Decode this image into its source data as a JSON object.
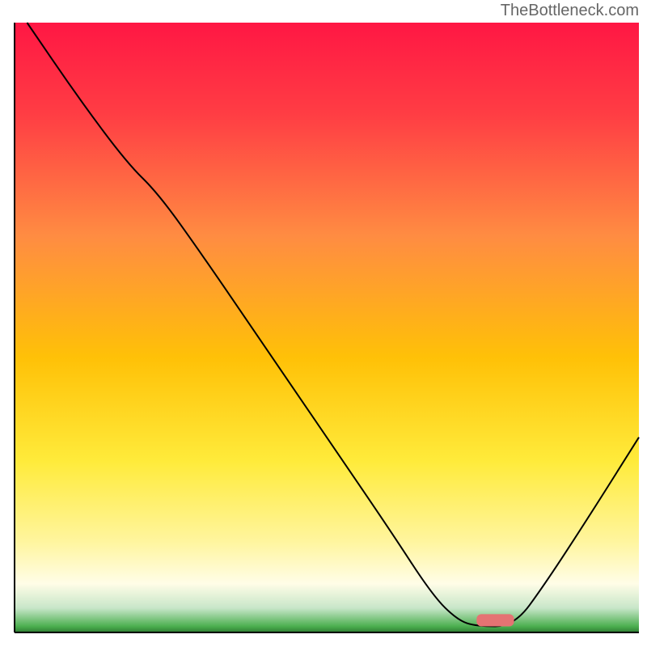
{
  "watermark": "TheBottleneck.com",
  "chart_data": {
    "type": "line",
    "title": "",
    "xlabel": "",
    "ylabel": "",
    "xlim": [
      0,
      100
    ],
    "ylim": [
      0,
      100
    ],
    "background": {
      "type": "vertical-gradient",
      "stops": [
        {
          "offset": 0,
          "color": "#ff1744"
        },
        {
          "offset": 15,
          "color": "#ff3d44"
        },
        {
          "offset": 35,
          "color": "#ff8c42"
        },
        {
          "offset": 55,
          "color": "#ffc107"
        },
        {
          "offset": 72,
          "color": "#ffeb3b"
        },
        {
          "offset": 85,
          "color": "#fff59d"
        },
        {
          "offset": 92,
          "color": "#fffde7"
        },
        {
          "offset": 96,
          "color": "#c8e6c9"
        },
        {
          "offset": 99,
          "color": "#4caf50"
        },
        {
          "offset": 100,
          "color": "#2e7d32"
        }
      ]
    },
    "series": [
      {
        "name": "bottleneck-curve",
        "color": "#000000",
        "stroke_width": 2,
        "points": [
          {
            "x": 2,
            "y": 100
          },
          {
            "x": 10,
            "y": 88
          },
          {
            "x": 18,
            "y": 77
          },
          {
            "x": 23,
            "y": 72
          },
          {
            "x": 30,
            "y": 62
          },
          {
            "x": 40,
            "y": 47
          },
          {
            "x": 50,
            "y": 32
          },
          {
            "x": 60,
            "y": 17
          },
          {
            "x": 67,
            "y": 6
          },
          {
            "x": 71,
            "y": 2
          },
          {
            "x": 74,
            "y": 1
          },
          {
            "x": 80,
            "y": 1
          },
          {
            "x": 85,
            "y": 8
          },
          {
            "x": 92,
            "y": 19
          },
          {
            "x": 100,
            "y": 32
          }
        ]
      }
    ],
    "marker": {
      "type": "rounded-bar",
      "x_start": 74,
      "x_end": 80,
      "y": 2,
      "color": "#e57373",
      "height": 2
    }
  }
}
